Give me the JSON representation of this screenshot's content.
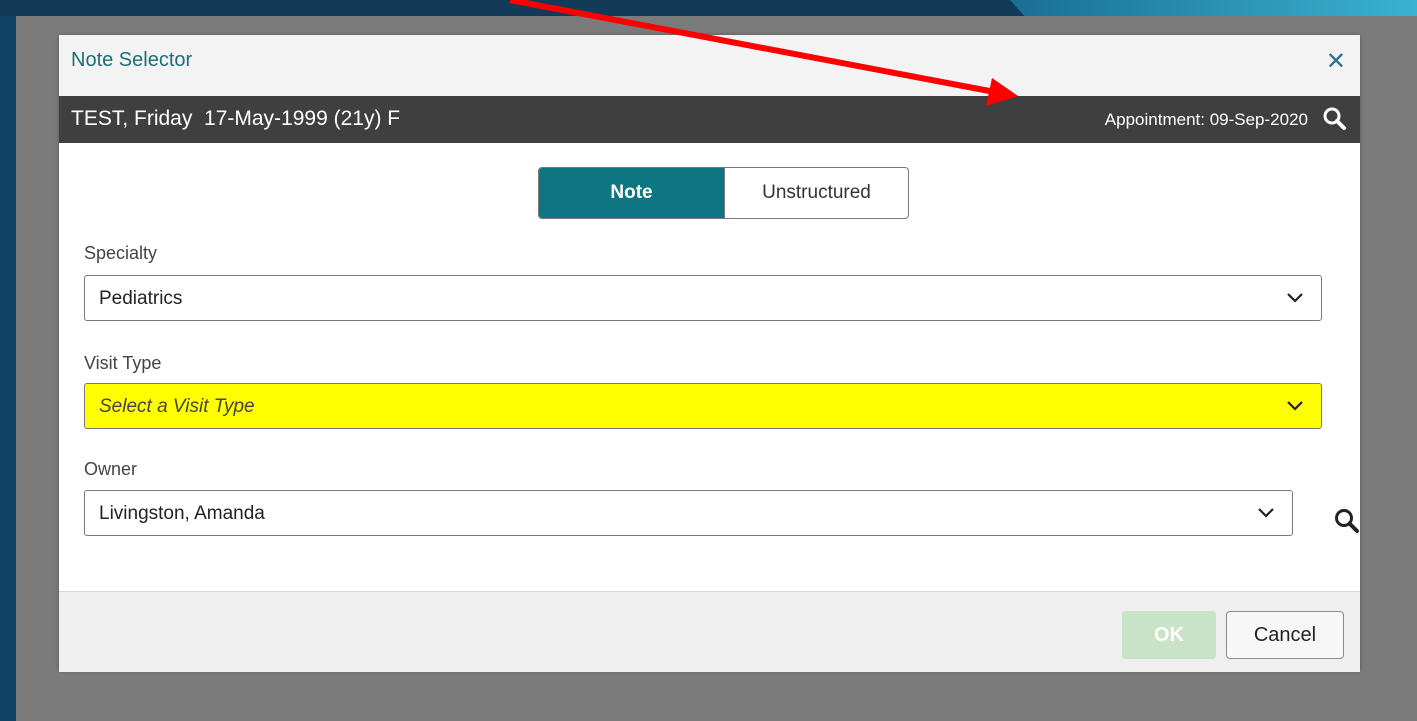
{
  "dialog": {
    "title": "Note Selector",
    "close_icon": "close-icon"
  },
  "patient": {
    "name_line": "TEST, Friday  17-May-1999 (21y) F",
    "appointment": "Appointment: 09-Sep-2020",
    "search_icon": "search-icon"
  },
  "toggle": {
    "note_label": "Note",
    "unstructured_label": "Unstructured",
    "selected": "Note"
  },
  "fields": {
    "specialty": {
      "label": "Specialty",
      "value": "Pediatrics"
    },
    "visit_type": {
      "label": "Visit Type",
      "placeholder": "Select a Visit Type",
      "highlight_color": "#ffff00"
    },
    "owner": {
      "label": "Owner",
      "value": "Livingston, Amanda"
    }
  },
  "buttons": {
    "ok_label": "OK",
    "ok_disabled": true,
    "cancel_label": "Cancel"
  },
  "colors": {
    "accent": "#0e7582",
    "annotation_arrow": "#ff0000"
  }
}
